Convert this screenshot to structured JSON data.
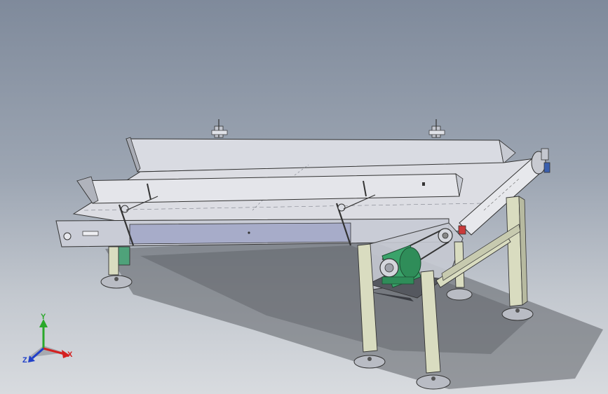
{
  "viewport": {
    "background_top": "#7f8a9b",
    "background_bottom": "#d8dbdf"
  },
  "model": {
    "frame_color": "#d9dcc0",
    "plate_color": "#c9ccd6",
    "motor_color": "#3aa36a",
    "foot_pad_color": "#b9bcc4"
  },
  "triad": {
    "x_label": "X",
    "y_label": "Y",
    "z_label": "Z",
    "x_color": "#d42020",
    "y_color": "#2aa82a",
    "z_color": "#2040c8"
  }
}
